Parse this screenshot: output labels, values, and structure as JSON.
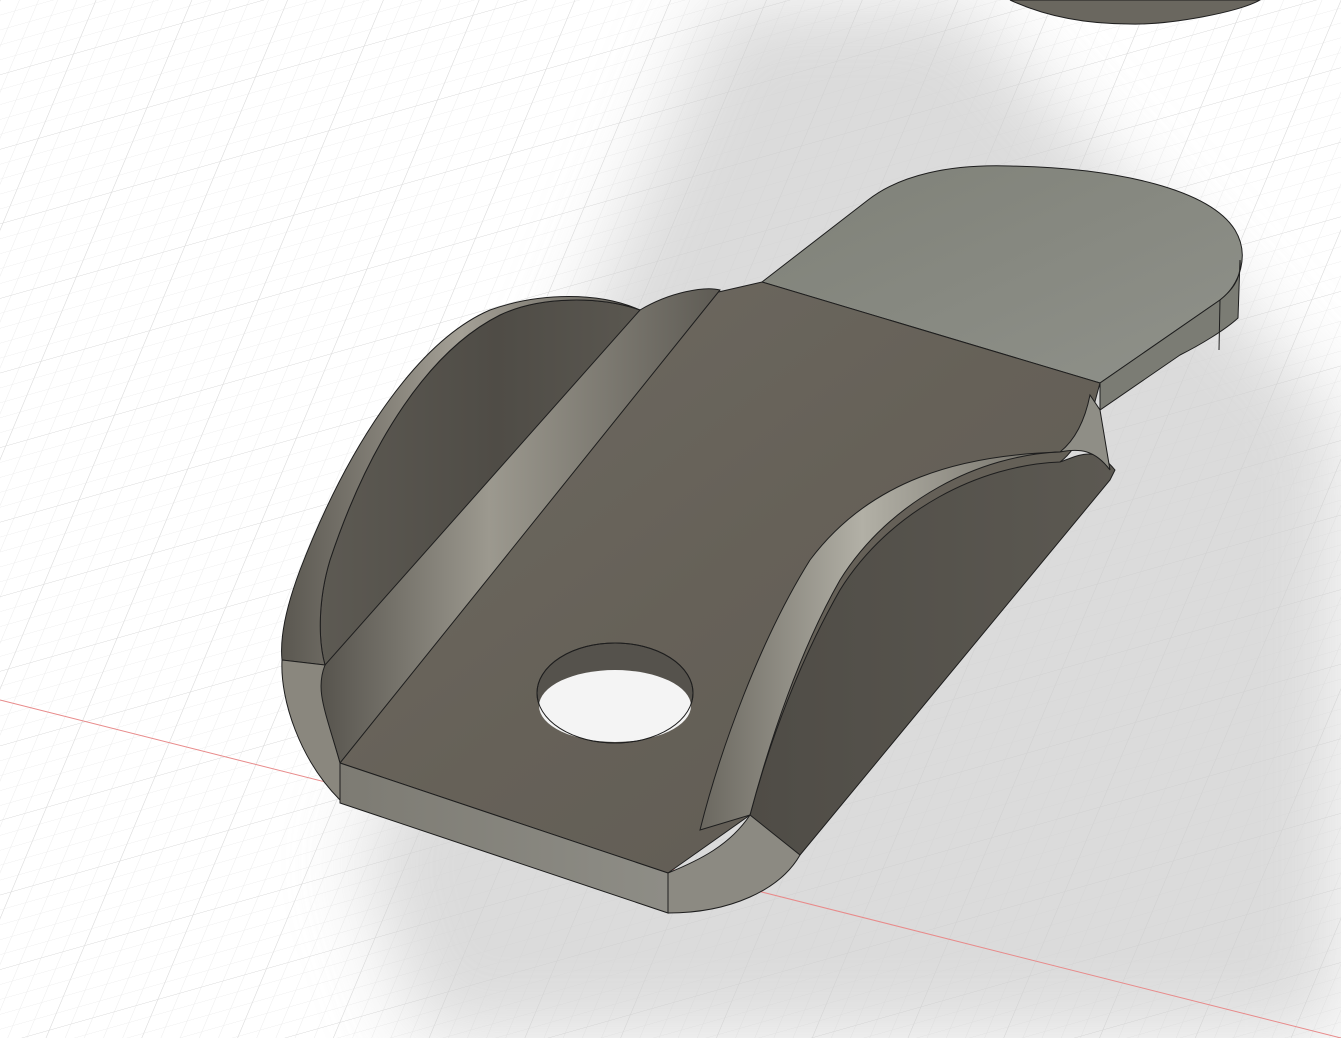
{
  "app": {
    "view": "3d-viewport",
    "shading": "shaded-with-visible-edges"
  },
  "scene": {
    "background_color": "#ffffff",
    "grid": {
      "visible": true,
      "minor_color": "#ececec",
      "major_color": "#d9d9d9"
    },
    "axis_color": "#e88a8a",
    "shadow_color": "#cfcfcf",
    "model": {
      "name": "bracket",
      "material_color": "#6b665f",
      "highlight_color": "#a9a79d",
      "edge_color": "#1e1e1e",
      "features": [
        "base-plate",
        "left-flange",
        "right-flange",
        "rounded-tab",
        "mounting-hole"
      ]
    },
    "background_parts": [
      "partial-body-top"
    ]
  }
}
